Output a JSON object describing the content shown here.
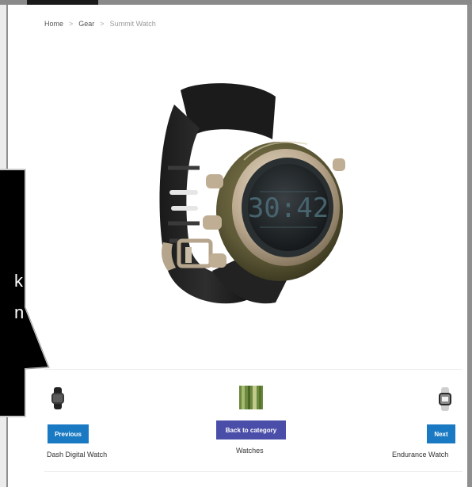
{
  "breadcrumb": {
    "items": [
      "Home",
      "Gear"
    ],
    "separator": ">",
    "current": "Summit Watch"
  },
  "product": {
    "image_icon": "watch-image",
    "display_reading": "30:42"
  },
  "callout": {
    "visible_chars": [
      "k",
      "n"
    ]
  },
  "navigation": {
    "previous": {
      "button_label": "Previous",
      "product_name": "Dash Digital Watch"
    },
    "category": {
      "button_label": "Back to category",
      "category_name": "Watches"
    },
    "next": {
      "button_label": "Next",
      "product_name": "Endurance Watch"
    }
  },
  "colors": {
    "primary_button": "#1979c3",
    "category_button": "#4a4ea8",
    "callout_bg": "#000000"
  }
}
